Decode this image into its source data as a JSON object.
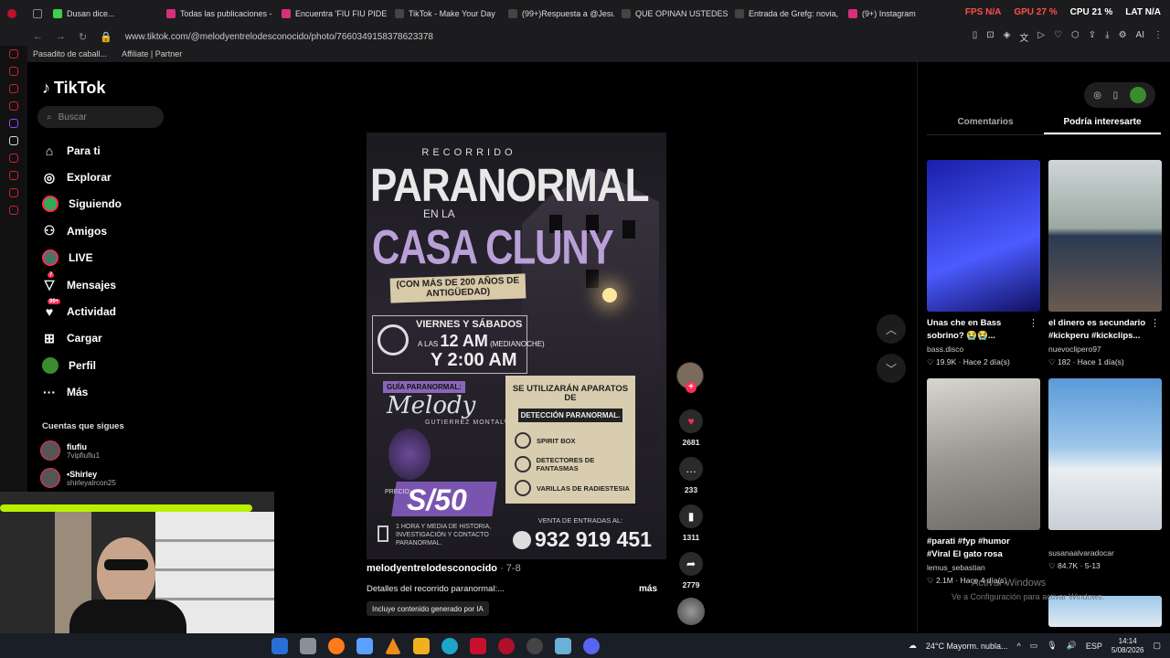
{
  "tabs": [
    {
      "label": "Dusan dice...",
      "color": "#3fcf4a"
    },
    {
      "label": "Todas las publicaciones -",
      "color": "#d6307a"
    },
    {
      "label": "Encuentra 'FIU FIU PIDE",
      "color": "#d6307a"
    },
    {
      "label": "TikTok - Make Your Day",
      "color": "#444"
    },
    {
      "label": "(99+)Respuesta a @Jesu",
      "color": "#444"
    },
    {
      "label": "QUE OPINAN USTEDES?",
      "color": "#444"
    },
    {
      "label": "Entrada de Grefg: novia,",
      "color": "#444"
    },
    {
      "label": "(9+) Instagram",
      "color": "#d6307a"
    }
  ],
  "sysstat": {
    "fps": "FPS N/A",
    "gpu": "GPU 27 %",
    "cpu": "CPU 21 %",
    "lat": "LAT N/A"
  },
  "address": {
    "url": "www.tiktok.com/@melodyentrelodesconocido/photo/7660349158378623378"
  },
  "bookmarks": [
    "Pasadito de caball...",
    "Affiliate | Partner"
  ],
  "tiktok": {
    "logo": "TikTok",
    "search_placeholder": "Buscar",
    "nav": [
      {
        "label": "Para ti",
        "icon": "home-icon",
        "glyph": "⌂"
      },
      {
        "label": "Explorar",
        "icon": "compass-icon",
        "glyph": "◎"
      },
      {
        "label": "Siguiendo",
        "icon": "following-avatar-icon",
        "glyph": "●"
      },
      {
        "label": "Amigos",
        "icon": "friends-icon",
        "glyph": "👥"
      },
      {
        "label": "LIVE",
        "icon": "live-avatar-icon",
        "glyph": "●"
      },
      {
        "label": "Mensajes",
        "icon": "messages-icon",
        "glyph": "▽",
        "badge": "7"
      },
      {
        "label": "Actividad",
        "icon": "activity-icon",
        "glyph": "♥",
        "badge": "99+"
      },
      {
        "label": "Cargar",
        "icon": "upload-icon",
        "glyph": "⊞"
      },
      {
        "label": "Perfil",
        "icon": "profile-avatar-icon",
        "glyph": "●"
      },
      {
        "label": "Más",
        "icon": "more-icon",
        "glyph": "···"
      }
    ],
    "following_title": "Cuentas que sigues",
    "following": [
      {
        "name": "fiufiu",
        "user": "7vipfiufiu1"
      },
      {
        "name": "•Shirley",
        "user": "shirleyalrcon25"
      }
    ]
  },
  "poster": {
    "kicker": "RECORRIDO",
    "title1": "PARANORMAL",
    "title2": "EN LA",
    "title3": "CASA CLUNY",
    "antiguedad": "(CON MÁS DE 200 AÑOS DE ANTIGÜEDAD)",
    "days": "VIERNES Y SÁBADOS",
    "time1_pre": "A LAS",
    "time1": "12 AM",
    "time1_note": "(MEDIANOCHE)",
    "time2": "Y 2:00 AM",
    "guide_label": "GUÍA PARANORMAL:",
    "guide_name": "Melody",
    "guide_surname": "GUTIERREZ MONTALVA",
    "price_label": "PRECIO:",
    "price": "S/50",
    "duration": "1 HORA Y MEDIA DE HISTORIA, INVESTIGACIÓN Y CONTACTO PARANORMAL.",
    "panel_title": "SE UTILIZARÁN APARATOS DE",
    "panel_detect": "DETECCIÓN PARANORMAL.",
    "panel_items": [
      "SPIRIT BOX",
      "DETECTORES DE FANTASMAS",
      "VARILLAS DE RADIESTESIA"
    ],
    "sales_label": "VENTA DE ENTRADAS AL:",
    "phone": "932 919 451"
  },
  "video": {
    "author": "melodyentrelodesconocido",
    "date": " · 7-8",
    "description": "Detalles del recorrido paranormal:...",
    "more": "más",
    "ai_label": "Incluye contenido generado por IA"
  },
  "actions": {
    "likes": "2681",
    "comments": "233",
    "saves": "1311",
    "shares": "2779"
  },
  "right": {
    "tabs": [
      "Comentarios",
      "Podría interesarte"
    ],
    "cards": [
      {
        "caption": "Unas che en Bass sobrino? 😭😭...",
        "author": "bass.disco",
        "likes": "19.9K",
        "time": "Hace 2 día(s)",
        "color": "#2a2fc0"
      },
      {
        "caption": "el dinero es secundario #kickperu #kickclips...",
        "author": "nuevoclipero97",
        "likes": "182",
        "time": "Hace 1 día(s)",
        "color": "#7a6d5e"
      },
      {
        "caption": "#parati #fyp #humor #Viral El gato rosa",
        "author": "lemus_sebastian",
        "likes": "2.1M",
        "time": "Hace 4 día(s)",
        "color": "#8a8a86"
      },
      {
        "caption": "",
        "author": "susanaalvaradocar",
        "likes": "84.7K",
        "time": "5-13",
        "color": "#7fb3d8"
      }
    ],
    "watermark1": "Activar Windows",
    "watermark2": "Ve a Configuración para activar Windows."
  },
  "taskbar": {
    "weather": "24°C  Mayorm. nubla...",
    "lang": "ESP",
    "time": "14:14",
    "date": "5/08/2026"
  }
}
